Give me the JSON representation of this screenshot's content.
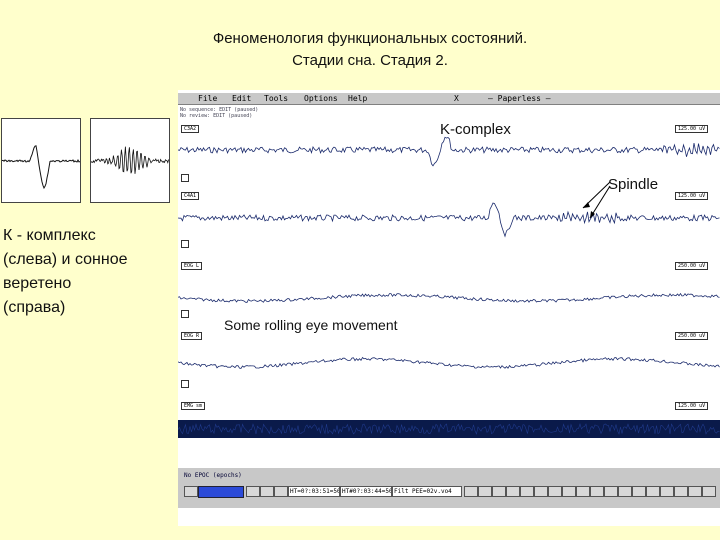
{
  "slide": {
    "title_line1": "Феноменология функциональных состояний.",
    "title_line2": "Стадии сна. Стадия 2.",
    "caption": [
      "К - комплекс",
      "(слева) и сонное",
      "веретено",
      "(справа)"
    ]
  },
  "app": {
    "menu": [
      "File",
      "Edit",
      "Tools",
      "Options",
      "Help",
      "X",
      "— Paperless —"
    ],
    "status_lines": [
      "No sequence: EDIT (paused)",
      "No review: EDIT (paused)"
    ],
    "channels": [
      {
        "tag": "C3A2",
        "scale": "125.00 uV"
      },
      {
        "tag": "C4A1",
        "scale": "125.00 uV"
      },
      {
        "tag": "EOG L",
        "scale": "250.00 uV"
      },
      {
        "tag": "EOG R",
        "scale": "250.00 uV"
      },
      {
        "tag": "EMG sm",
        "scale": "125.00 uV"
      }
    ],
    "annotations": {
      "k_complex": "K-complex",
      "spindle": "Spindle",
      "eye_movement": "Some rolling eye movement"
    },
    "bottom_message": "No EPOC (epochs)",
    "toolbar_fields": [
      "HT=0?:03:51=508",
      "HT#0?:03:44=508",
      "Filt PEE=02v.vo4"
    ]
  },
  "colors": {
    "background": "#ffffcc",
    "trace": "#1a2a6c",
    "toolbar": "#c8c8c8"
  }
}
